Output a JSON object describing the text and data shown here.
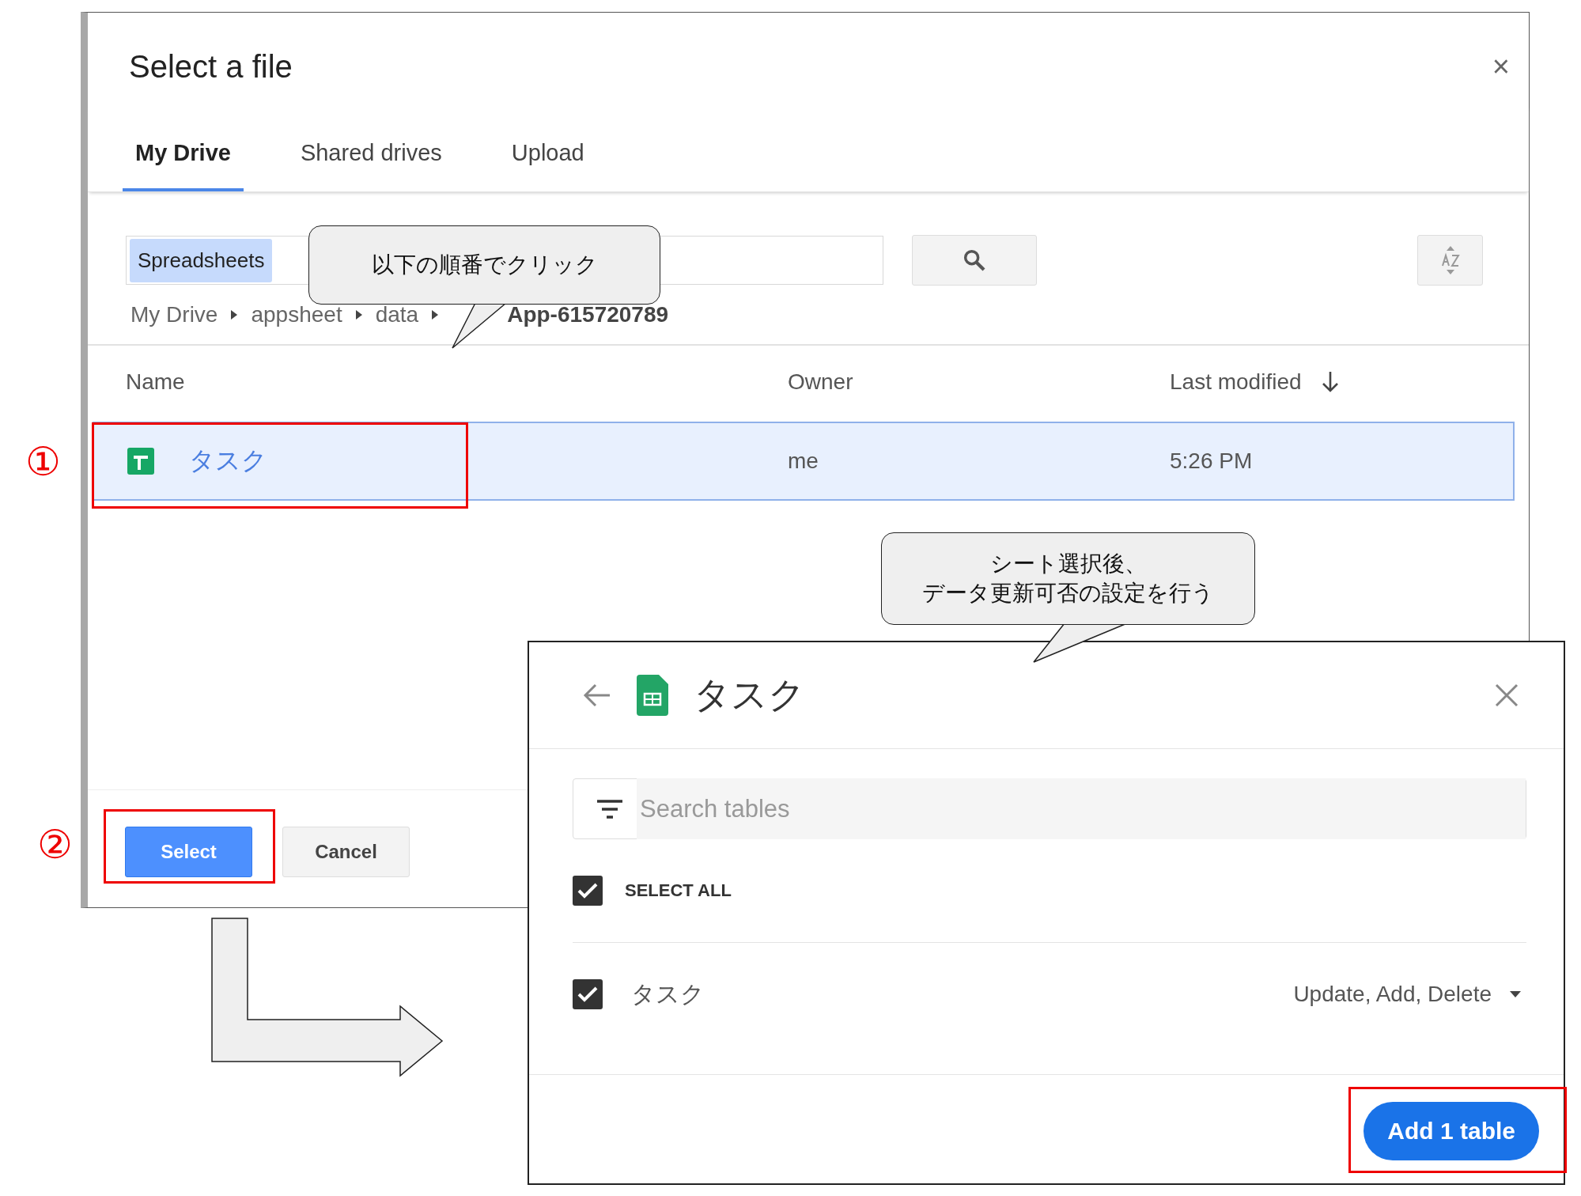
{
  "file_dialog": {
    "title": "Select a file",
    "close": "×",
    "tabs": [
      {
        "label": "My Drive",
        "selected": true
      },
      {
        "label": "Shared drives",
        "selected": false
      },
      {
        "label": "Upload",
        "selected": false
      }
    ],
    "filter_chip": "Spreadsheets",
    "breadcrumb": [
      "My Drive",
      "appsheet",
      "data",
      "App-615720789"
    ],
    "columns": [
      "Name",
      "Owner",
      "Last modified"
    ],
    "rows": [
      {
        "name": "タスク",
        "owner": "me",
        "modified": "5:26 PM",
        "selected": true
      }
    ],
    "buttons": [
      {
        "label": "Select",
        "kind": "primary"
      },
      {
        "label": "Cancel",
        "kind": "secondary"
      }
    ]
  },
  "table_dialog": {
    "title": "タスク",
    "search": {
      "placeholder": "Search tables"
    },
    "select_all": {
      "label": "SELECT ALL",
      "checked": true
    },
    "tables": [
      {
        "name": "タスク",
        "checked": true,
        "permission": "Update, Add, Delete"
      }
    ],
    "add_button": "Add 1 table"
  },
  "annotations": {
    "callouts": [
      {
        "lines": [
          "以下の順番でクリック"
        ]
      },
      {
        "lines": [
          "シート選択後、",
          "データ更新可否の設定を行う"
        ]
      }
    ],
    "steps": [
      "①",
      "②"
    ]
  }
}
